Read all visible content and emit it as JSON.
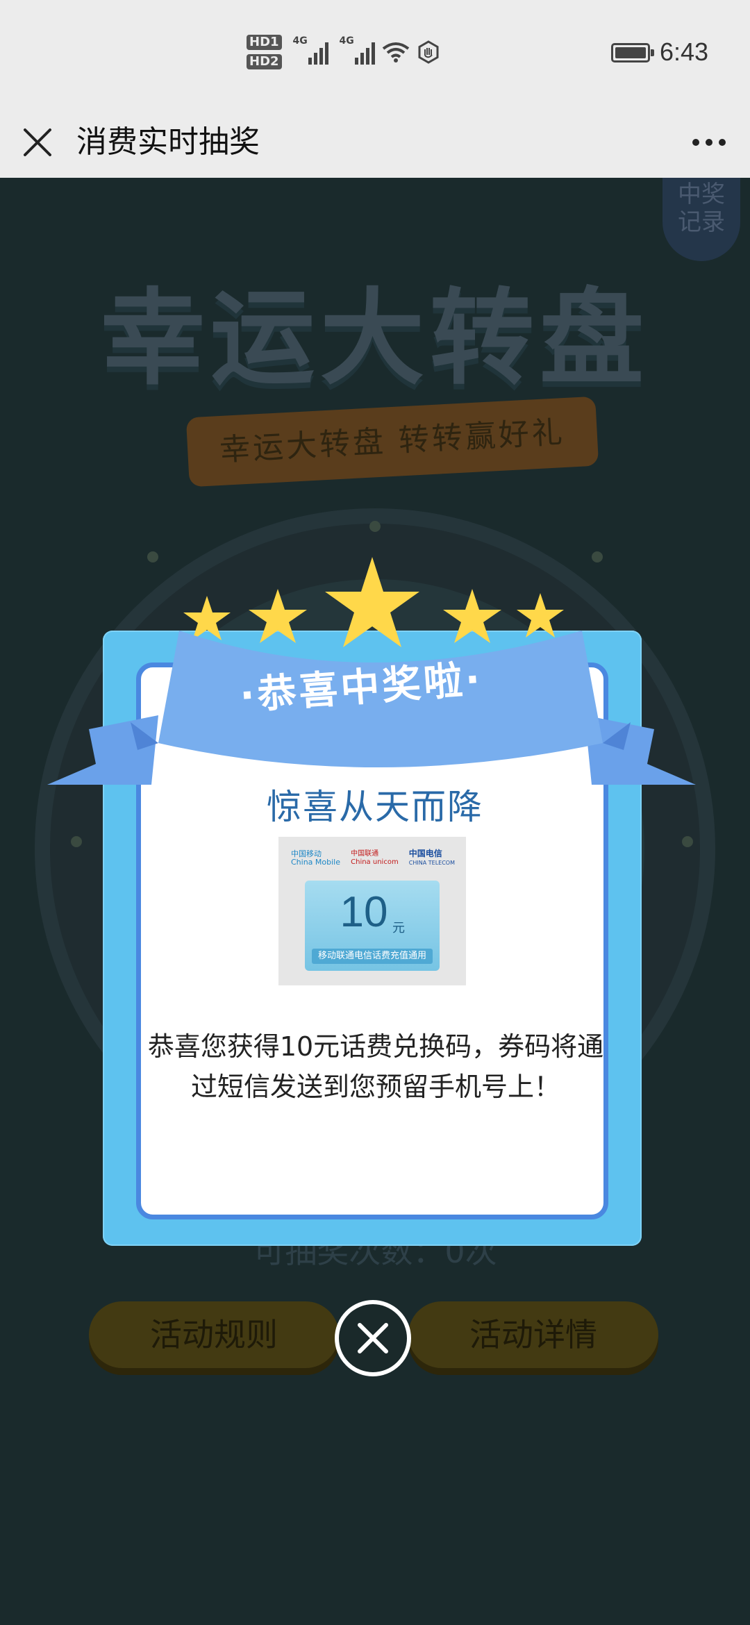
{
  "status_bar": {
    "hd1": "HD",
    "hd1_sub": "1",
    "hd2": "HD",
    "hd2_sub": "2",
    "net1": "4G",
    "net2": "4G",
    "time": "6:43"
  },
  "nav": {
    "title": "消费实时抽奖"
  },
  "background": {
    "record_label": "中奖\n记录",
    "title": "幸运大转盘",
    "subtitle": "幸运大转盘 转转赢好礼",
    "chances": "可抽奖次数：0次",
    "rules_button": "活动规则",
    "detail_button": "活动详情"
  },
  "modal": {
    "banner": "·恭喜中奖啦·",
    "heading": "惊喜从天而降",
    "card": {
      "logo_mobile": "中国移动",
      "logo_mobile_en": "China Mobile",
      "logo_unicom": "中国联通",
      "logo_unicom_en": "China unicom",
      "logo_telecom": "中国电信",
      "logo_telecom_en": "CHINA TELECOM",
      "amount": "10",
      "unit": "元",
      "note": "移动联通电信话费充值通用"
    },
    "message": "恭喜您获得10元话费兑换码，券码将通过短信发送到您预留手机号上！"
  },
  "colors": {
    "modal_frame": "#5ec2ef",
    "modal_border": "#4a88e0",
    "banner": "#78aeee",
    "star": "#ffd84a",
    "heading": "#2a6aa8"
  }
}
